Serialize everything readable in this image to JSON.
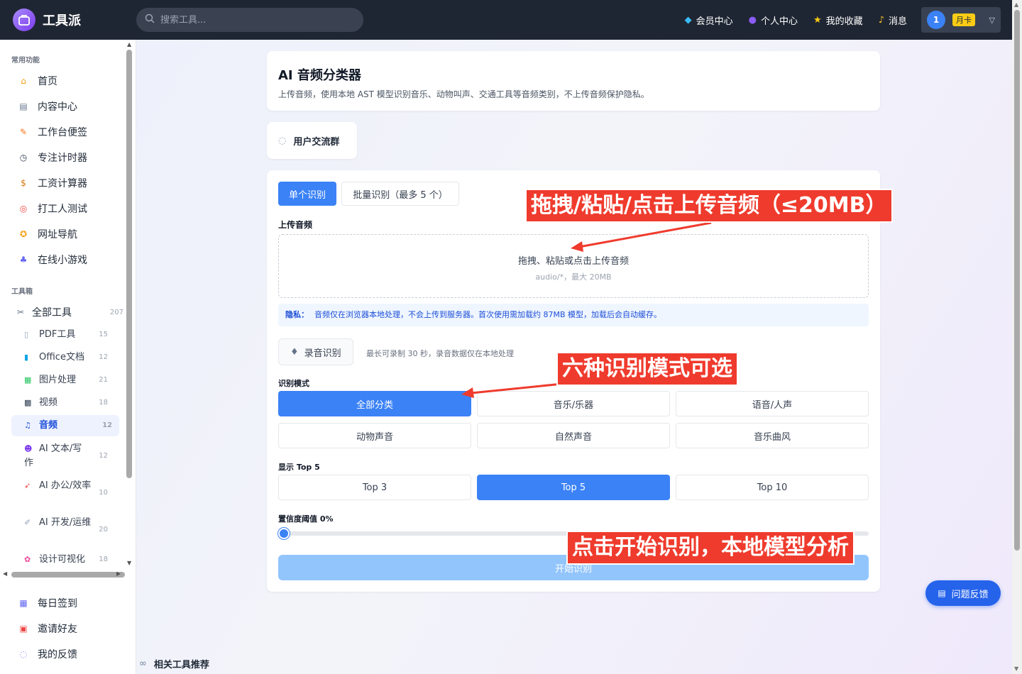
{
  "header": {
    "logo_text": "工具派",
    "search_placeholder": "搜索工具...",
    "nav": [
      {
        "label": "会员中心",
        "icon": "diamond-icon"
      },
      {
        "label": "个人中心",
        "icon": "user-icon"
      },
      {
        "label": "我的收藏",
        "icon": "star-icon"
      },
      {
        "label": "消息",
        "icon": "bell-icon"
      }
    ],
    "user": {
      "avatar_text": "1",
      "plan_badge": "月卡"
    }
  },
  "sidebar": {
    "common_title": "常用功能",
    "common_items": [
      {
        "label": "首页",
        "icon": "home-icon"
      },
      {
        "label": "内容中心",
        "icon": "news-icon"
      },
      {
        "label": "工作台便签",
        "icon": "memo-icon"
      },
      {
        "label": "专注计时器",
        "icon": "timer-icon"
      },
      {
        "label": "工资计算器",
        "icon": "money-bag-icon"
      },
      {
        "label": "打工人测试",
        "icon": "target-icon"
      },
      {
        "label": "网址导航",
        "icon": "compass-icon"
      },
      {
        "label": "在线小游戏",
        "icon": "gamepad-icon"
      }
    ],
    "toolbox_title": "工具箱",
    "all_tools": {
      "label": "全部工具",
      "count": "207"
    },
    "categories": [
      {
        "label": "PDF工具",
        "count": "15",
        "icon": "pdf-icon"
      },
      {
        "label": "Office文档",
        "count": "12",
        "icon": "office-icon"
      },
      {
        "label": "图片处理",
        "count": "21",
        "icon": "image-icon"
      },
      {
        "label": "视频",
        "count": "18",
        "icon": "clapper-icon"
      },
      {
        "label": "音频",
        "count": "12",
        "icon": "music-note-icon",
        "active": true
      },
      {
        "label": "AI 文本/写作",
        "count": "12",
        "icon": "robot-icon"
      },
      {
        "label": "AI 办公/效率",
        "count": "10",
        "icon": "rocket-icon"
      },
      {
        "label": "AI 开发/运维",
        "count": "20",
        "icon": "wrench-icon"
      },
      {
        "label": "设计可视化",
        "count": "18",
        "icon": "palette-icon"
      }
    ],
    "bottom_items": [
      {
        "label": "每日签到",
        "icon": "calendar-icon"
      },
      {
        "label": "邀请好友",
        "icon": "gift-icon"
      },
      {
        "label": "我的反馈",
        "icon": "speech-bubble-icon"
      }
    ]
  },
  "tool": {
    "title": "AI 音频分类器",
    "description": "上传音频，使用本地 AST 模型识别音乐、动物叫声、交通工具等音频类别，不上传音频保护隐私。",
    "community_label": "用户交流群",
    "tabs": [
      "单个识别",
      "批量识别（最多 5 个）"
    ],
    "upload_label": "上传音频",
    "drop_main": "拖拽、粘贴或点击上传音频",
    "drop_sub": "audio/*，最大 20MB",
    "privacy_tag": "隐私：",
    "privacy_text": "音频仅在浏览器本地处理，不会上传到服务器。首次使用需加载约 87MB 模型，加载后会自动缓存。",
    "record_label": "录音识别",
    "record_hint": "最长可录制 30 秒，录音数据仅在本地处理",
    "mode_label": "识别模式",
    "modes": [
      "全部分类",
      "音乐/乐器",
      "语音/人声",
      "动物声音",
      "自然声音",
      "音乐曲风"
    ],
    "selected_mode": "全部分类",
    "topn_label": "显示 Top 5",
    "topn_options": [
      "Top 3",
      "Top 5",
      "Top 10"
    ],
    "selected_topn": "Top 5",
    "threshold_label": "置信度阈值 0%",
    "threshold_value": 0,
    "start_label": "开始识别"
  },
  "annotations": [
    "拖拽/粘贴/点击上传音频（≤20MB）",
    "六种识别模式可选",
    "点击开始识别，本地模型分析"
  ],
  "feedback_label": "问题反馈",
  "related_label": "相关工具推荐",
  "colors": {
    "accent": "#3b82f6",
    "callout": "#ef3b2d",
    "topbar": "#1f2633"
  }
}
